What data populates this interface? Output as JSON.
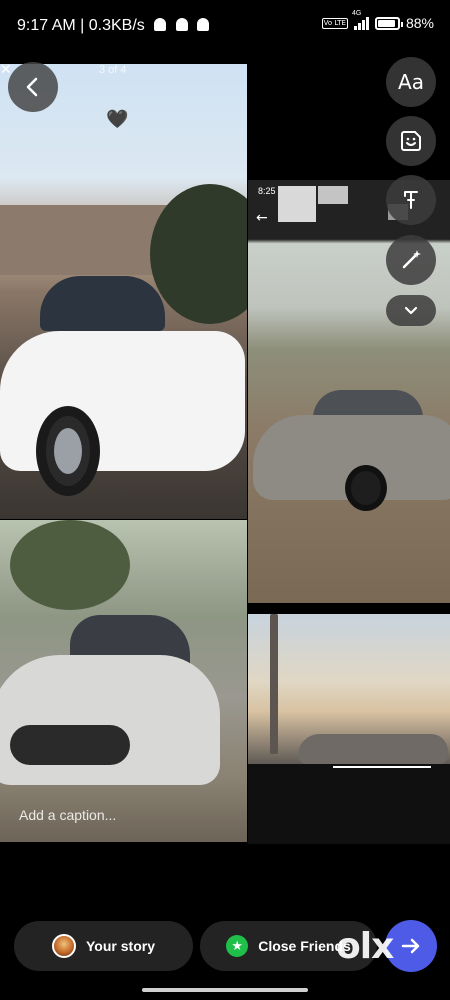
{
  "status_bar": {
    "time_speed": "9:17 AM | 0.3KB/s",
    "volte": "Vo LTE",
    "network": "4G",
    "battery_label": "88%",
    "battery_level": 0.88
  },
  "editor": {
    "photo_counter": "3 of 4",
    "close_glyph": "✕",
    "back_icon": "chevron-left-icon",
    "heart_glyph": "🖤",
    "tools": [
      {
        "name": "text-tool",
        "label": "Aa"
      },
      {
        "name": "sticker-tool",
        "icon": "sticker-icon"
      },
      {
        "name": "draw-tool",
        "icon": "pen-icon"
      },
      {
        "name": "effects-tool",
        "icon": "sparkle-wand-icon"
      }
    ],
    "more_icon": "chevron-down-icon",
    "caption_placeholder": "Add a caption...",
    "inner_screenshot_time": "8:25",
    "inner_back_glyph": "←"
  },
  "share_bar": {
    "your_story_label": "Your story",
    "close_friends_label": "Close Friends",
    "send_icon": "arrow-right-icon",
    "star_glyph": "★"
  },
  "watermark": "olx"
}
